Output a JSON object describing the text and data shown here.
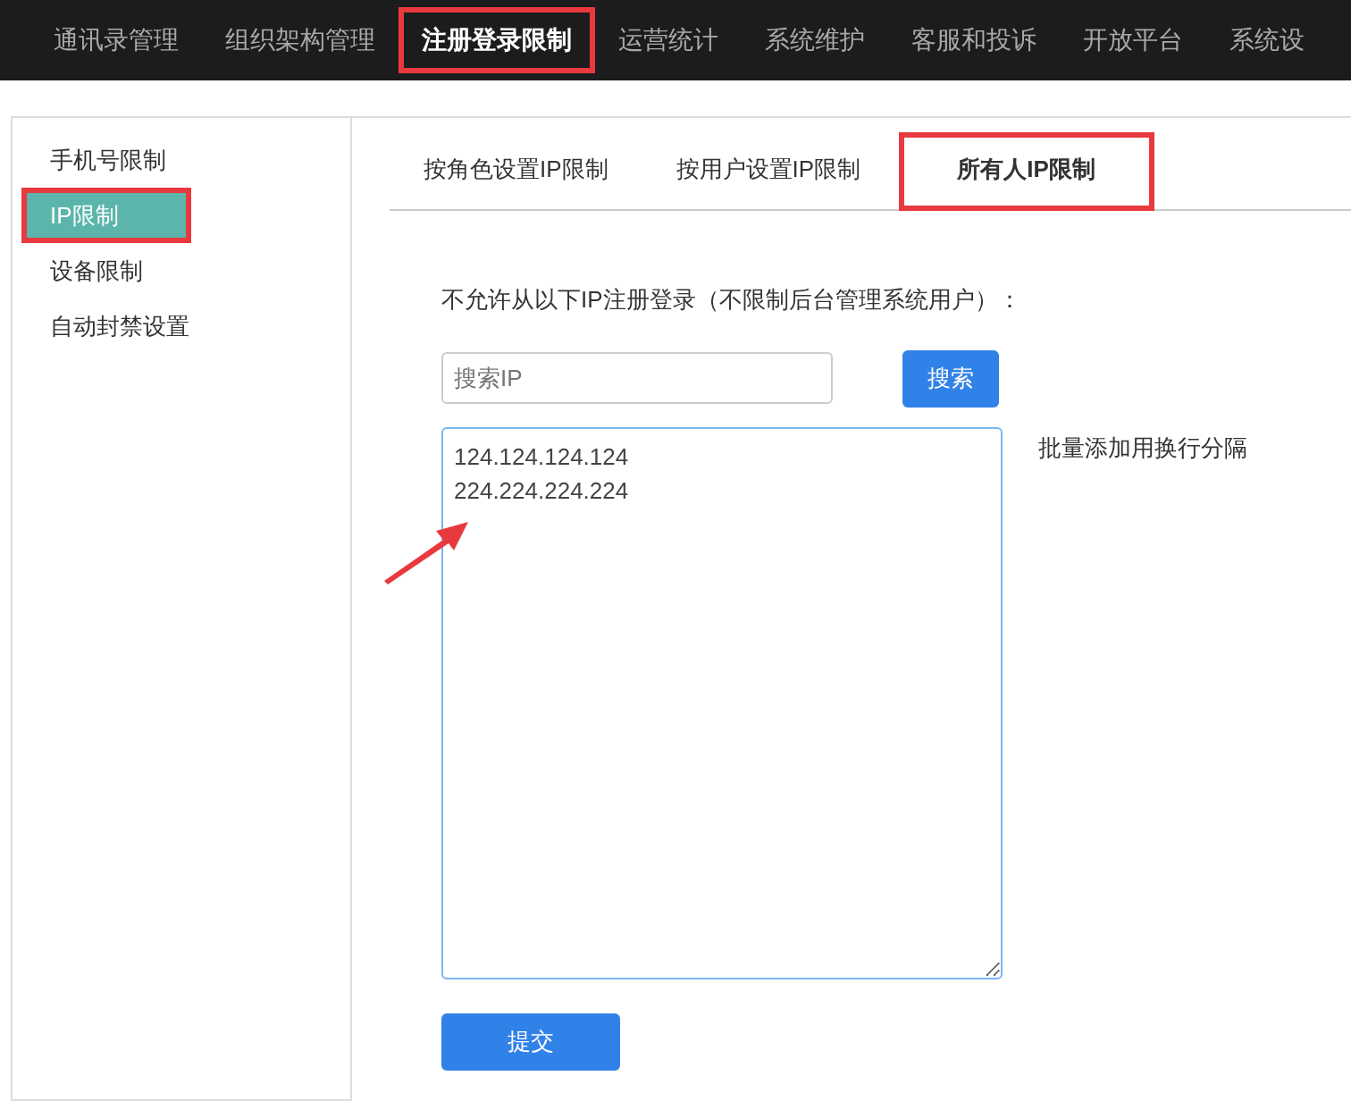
{
  "top_nav": [
    {
      "label": "通讯录管理",
      "selected": false,
      "highlighted": false
    },
    {
      "label": "组织架构管理",
      "selected": false,
      "highlighted": false
    },
    {
      "label": "注册登录限制",
      "selected": true,
      "highlighted": true
    },
    {
      "label": "运营统计",
      "selected": false,
      "highlighted": false
    },
    {
      "label": "系统维护",
      "selected": false,
      "highlighted": false
    },
    {
      "label": "客服和投诉",
      "selected": false,
      "highlighted": false
    },
    {
      "label": "开放平台",
      "selected": false,
      "highlighted": false
    },
    {
      "label": "系统设",
      "selected": false,
      "highlighted": false
    }
  ],
  "sidebar": {
    "items": [
      {
        "label": "手机号限制",
        "selected": false,
        "highlighted": false
      },
      {
        "label": "IP限制",
        "selected": true,
        "highlighted": true
      },
      {
        "label": "设备限制",
        "selected": false,
        "highlighted": false
      },
      {
        "label": "自动封禁设置",
        "selected": false,
        "highlighted": false
      }
    ]
  },
  "tabs": [
    {
      "label": "按角色设置IP限制",
      "selected": false,
      "highlighted": false
    },
    {
      "label": "按用户设置IP限制",
      "selected": false,
      "highlighted": false
    },
    {
      "label": "所有人IP限制",
      "selected": true,
      "highlighted": true
    }
  ],
  "form": {
    "description": "不允许从以下IP注册登录（不限制后台管理系统用户）：",
    "search": {
      "placeholder": "搜索IP",
      "button": "搜索"
    },
    "ip_list": {
      "value": "124.124.124.124\n224.224.224.224",
      "hint": "批量添加用换行分隔"
    },
    "submit": "提交"
  },
  "annotation_arrow": true
}
